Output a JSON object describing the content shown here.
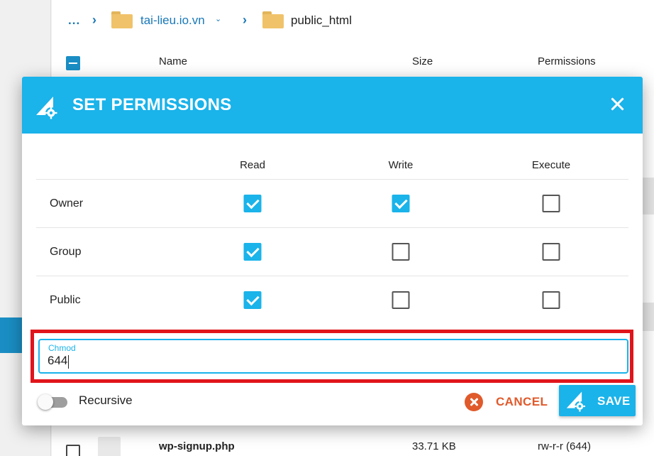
{
  "breadcrumb": {
    "ellipsis": "...",
    "items": [
      {
        "label": "tai-lieu.io.vn",
        "has_dropdown": true
      },
      {
        "label": "public_html"
      }
    ]
  },
  "file_table": {
    "columns": [
      "Name",
      "Size",
      "Permissions"
    ],
    "visible_row": {
      "name": "wp-signup.php",
      "size": "33.71 KB",
      "permissions": "rw-r-r (644)"
    }
  },
  "dialog": {
    "title": "SET PERMISSIONS",
    "columns": [
      "Read",
      "Write",
      "Execute"
    ],
    "rows": [
      {
        "role": "Owner",
        "read": true,
        "write": true,
        "execute": false
      },
      {
        "role": "Group",
        "read": true,
        "write": false,
        "execute": false
      },
      {
        "role": "Public",
        "read": true,
        "write": false,
        "execute": false
      }
    ],
    "chmod": {
      "label": "Chmod",
      "value": "644"
    },
    "recursive": {
      "label": "Recursive",
      "on": false
    },
    "cancel_label": "CANCEL",
    "save_label": "SAVE"
  },
  "colors": {
    "accent": "#1ab3ea",
    "link": "#1978b8",
    "cancel": "#e05a2b",
    "highlight": "#e0151b",
    "folder": "#f0c36a"
  },
  "icons": {
    "folder": "folder-icon",
    "chevron": "chevron-right-icon",
    "close": "close-icon",
    "cancel": "cancel-circle-icon",
    "save": "permissions-gear-icon"
  }
}
